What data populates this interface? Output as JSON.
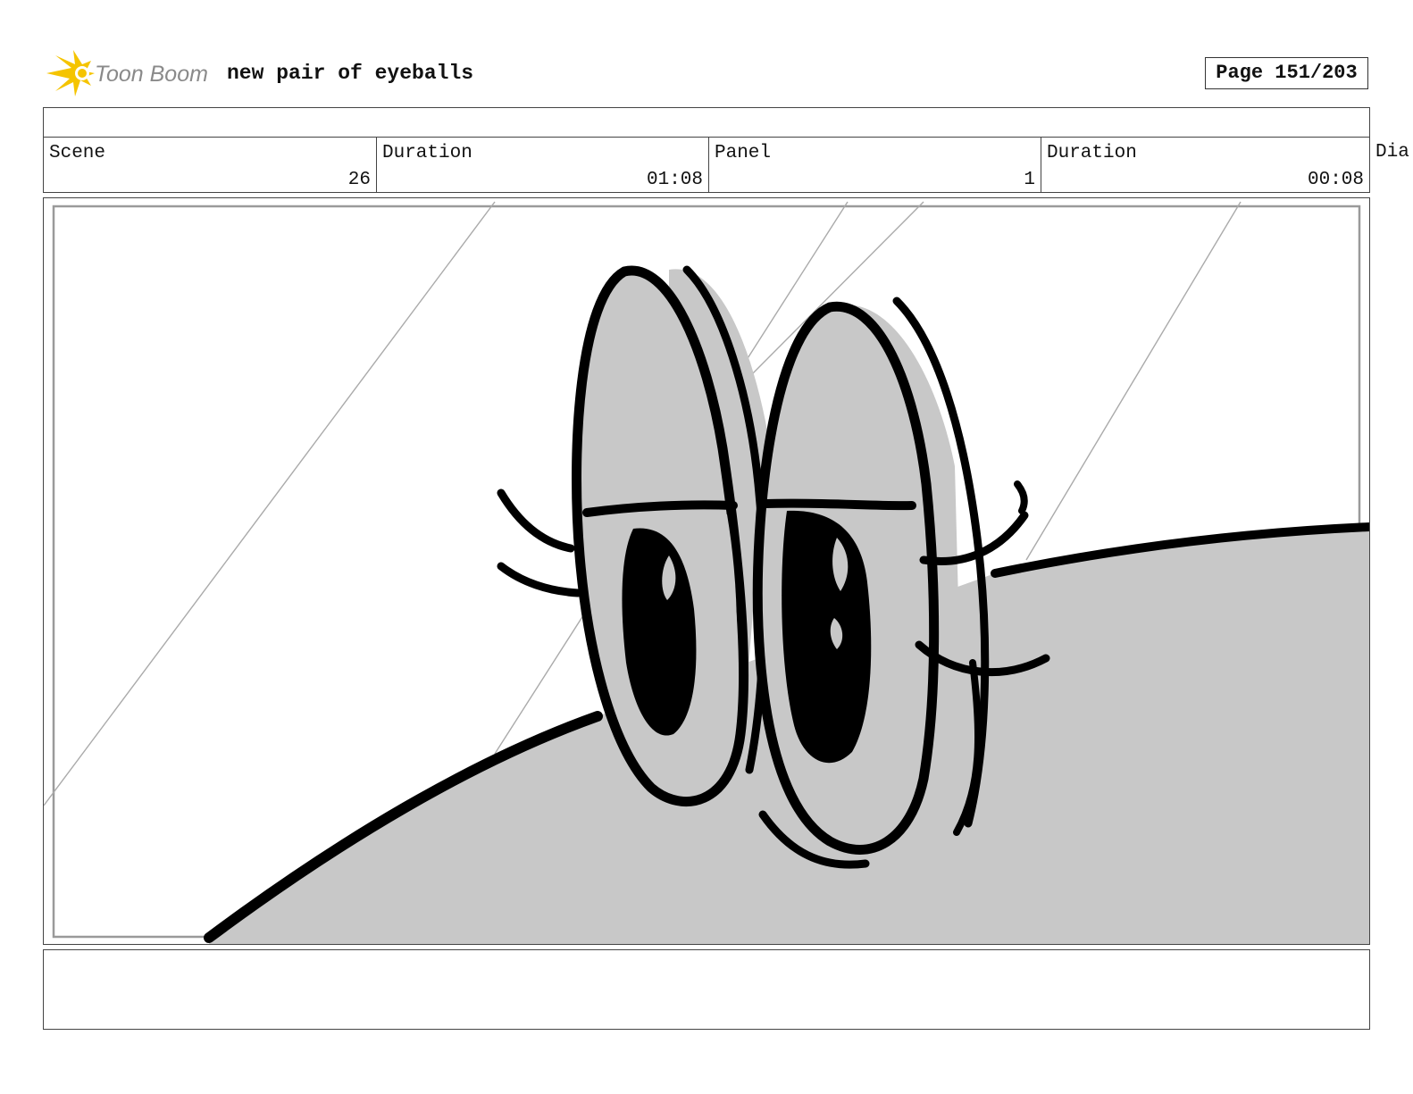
{
  "header": {
    "logo_text": "Toon Boom",
    "project_title": "new pair of eyeballs",
    "page_label": "Page 151/203"
  },
  "info": {
    "scene_label": "Scene",
    "scene_value": "26",
    "scene_duration_label": "Duration",
    "scene_duration_value": "01:08",
    "panel_label": "Panel",
    "panel_value": "1",
    "panel_duration_label": "Duration",
    "panel_duration_value": "00:08",
    "dialog_label_partial": "Dia"
  },
  "panel": {
    "icon": "storyboard-drawing-eyeballs"
  },
  "colors": {
    "logo_accent": "#f5c400",
    "logo_text": "#8a8a8a",
    "fill_gray": "#c8c8c8",
    "ink": "#000000"
  }
}
